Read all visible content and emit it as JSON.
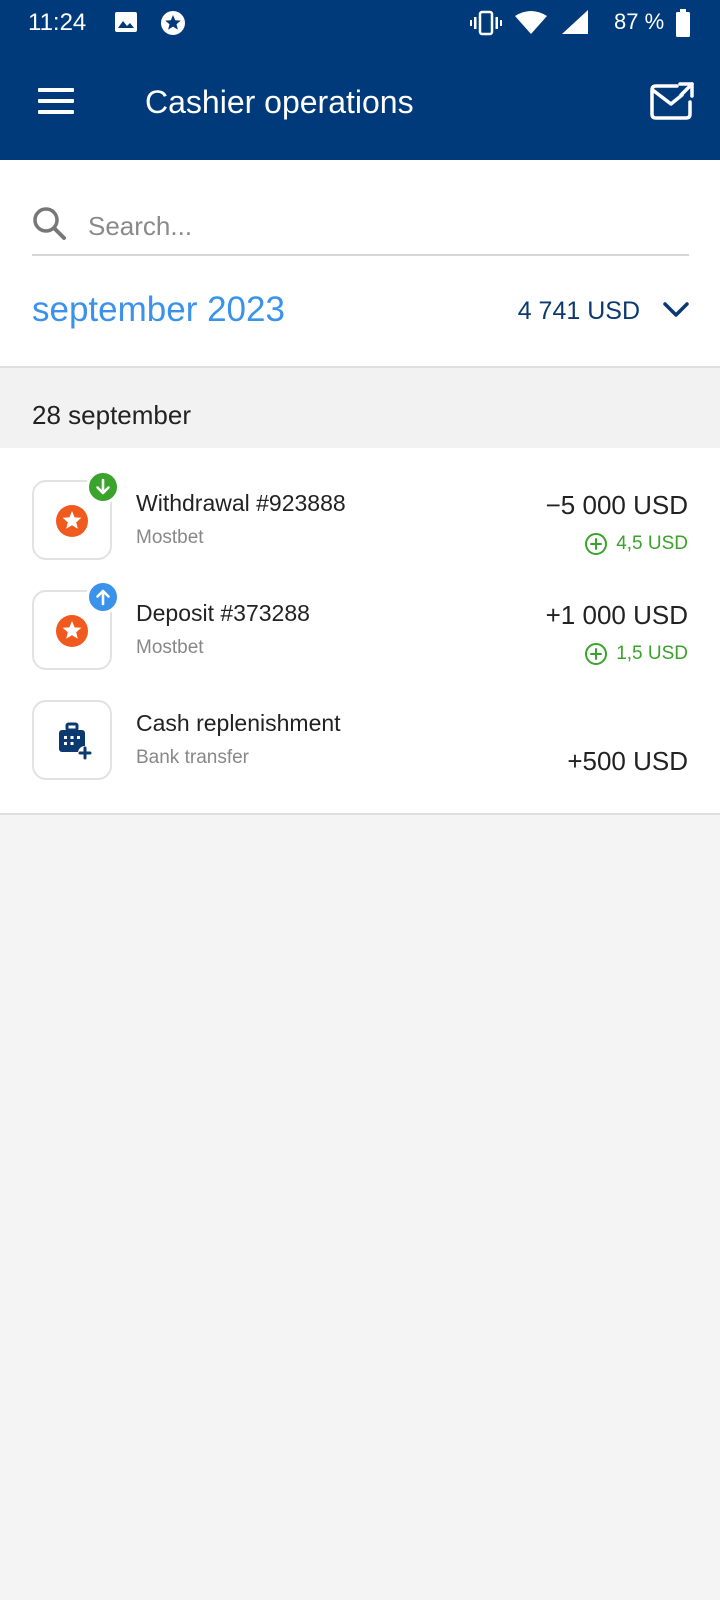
{
  "status_bar": {
    "time": "11:24",
    "battery": "87 %",
    "icons": [
      "image-icon",
      "star-app-icon",
      "vibrate-icon",
      "wifi-icon",
      "signal-icon",
      "battery-icon"
    ]
  },
  "app_bar": {
    "title": "Cashier operations",
    "menu_icon": "hamburger-menu-icon",
    "mail_icon": "mail-icon"
  },
  "search": {
    "placeholder": "Search...",
    "value": ""
  },
  "period": {
    "month_label": "september 2023",
    "total": "4 741 USD"
  },
  "groups": [
    {
      "date": "28 september",
      "transactions": [
        {
          "title": "Withdrawal #923888",
          "subtitle": "Mostbet",
          "amount": "−5 000 USD",
          "cashback": "4,5 USD",
          "icon": "mostbet-star-icon",
          "badge": "arrow-down-icon"
        },
        {
          "title": "Deposit #373288",
          "subtitle": "Mostbet",
          "amount": "+1 000 USD",
          "cashback": "1,5 USD",
          "icon": "mostbet-star-icon",
          "badge": "arrow-up-icon"
        },
        {
          "title": "Cash replenishment",
          "subtitle": "Bank transfer",
          "amount": "+500 USD",
          "icon": "cash-register-plus-icon"
        }
      ]
    }
  ],
  "colors": {
    "header_bg": "#003a7a",
    "accent_blue": "#3a92ea",
    "total_navy": "#0c3a70",
    "cashback_green": "#3aa32b",
    "withdraw_badge": "#3aa32b",
    "deposit_badge": "#3a92ea",
    "brand_orange": "#f05a1e"
  }
}
